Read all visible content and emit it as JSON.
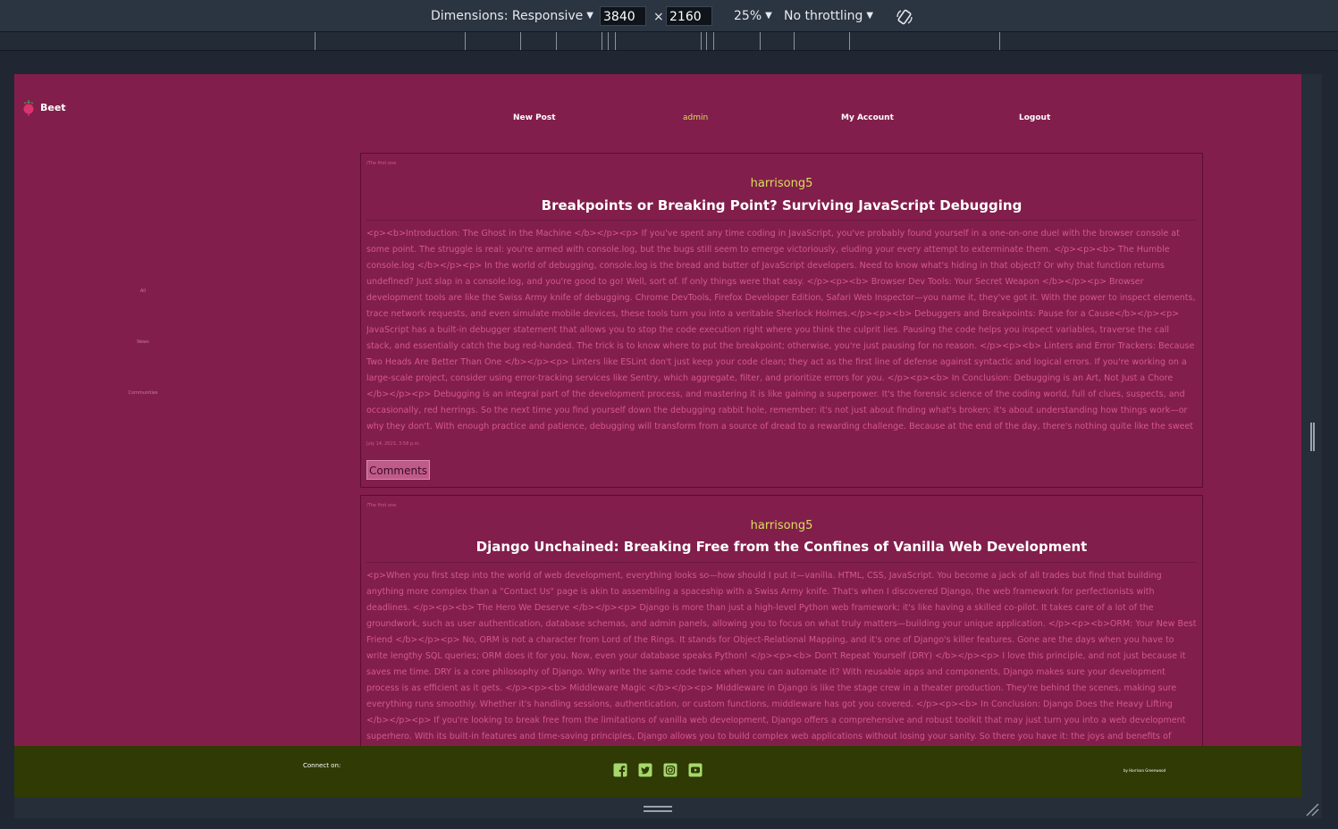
{
  "devtools": {
    "dimensions_label": "Dimensions: Responsive",
    "width_value": "3840",
    "times": "×",
    "height_value": "2160",
    "zoom": "25%",
    "throttling": "No throttling"
  },
  "site": {
    "brand": "Beet",
    "nav": {
      "new_post": "New Post",
      "admin": "admin",
      "my_account": "My Account",
      "logout": "Logout"
    },
    "sidebar": [
      "All",
      "News",
      "Communities"
    ]
  },
  "posts": [
    {
      "community": "/The first one",
      "author": "harrisong5",
      "title": "Breakpoints or Breaking Point? Surviving JavaScript Debugging",
      "body": "<p><b>Introduction: The Ghost in the Machine </b></p><p> If you've spent any time coding in JavaScript, you've probably found yourself in a one-on-one duel with the browser console at some point. The struggle is real: you're armed with console.log, but the bugs still seem to emerge victoriously, eluding your every attempt to exterminate them. </p><p><b> The Humble console.log </b></p><p> In the world of debugging, console.log is the bread and butter of JavaScript developers. Need to know what's hiding in that object? Or why that function returns undefined? Just slap in a console.log, and you're good to go! Well, sort of. If only things were that easy. </p><p><b> Browser Dev Tools: Your Secret Weapon </b></p><p> Browser development tools are like the Swiss Army knife of debugging. Chrome DevTools, Firefox Developer Edition, Safari Web Inspector—you name it, they've got it. With the power to inspect elements, trace network requests, and even simulate mobile devices, these tools turn you into a veritable Sherlock Holmes.</p><p><b> Debuggers and Breakpoints: Pause for a Cause</b></p><p> JavaScript has a built-in debugger statement that allows you to stop the code execution right where you think the culprit lies. Pausing the code helps you inspect variables, traverse the call stack, and essentially catch the bug red-handed. The trick is to know where to put the breakpoint; otherwise, you're just pausing for no reason. </p><p><b> Linters and Error Trackers: Because Two Heads Are Better Than One </b></p><p> Linters like ESLint don't just keep your code clean; they act as the first line of defense against syntactic and logical errors. If you're working on a large-scale project, consider using error-tracking services like Sentry, which aggregate, filter, and prioritize errors for you. </p><p><b> In Conclusion: Debugging is an Art, Not Just a Chore </b></p><p> Debugging is an integral part of the development process, and mastering it is like gaining a superpower. It's the forensic science of the coding world, full of clues, suspects, and occasionally, red herrings. So the next time you find yourself down the debugging rabbit hole, remember: it's not just about finding what's broken; it's about understanding how things work—or why they don't. With enough practice and patience, debugging will transform from a source of dread to a rewarding challenge. Because at the end of the day, there's nothing quite like the sweet victory of a bug-free script.</p>",
      "date": "July 14, 2023, 3:58 p.m.",
      "comments_label": "Comments"
    },
    {
      "community": "/The first one",
      "author": "harrisong5",
      "title": "Django Unchained: Breaking Free from the Confines of Vanilla Web Development",
      "body": "<p>When you first step into the world of web development, everything looks so—how should I put it—vanilla. HTML, CSS, JavaScript. You become a jack of all trades but find that building anything more complex than a \"Contact Us\" page is akin to assembling a spaceship with a Swiss Army knife. That's when I discovered Django, the web framework for perfectionists with deadlines. </p><p><b> The Hero We Deserve </b></p><p> Django is more than just a high-level Python web framework; it's like having a skilled co-pilot. It takes care of a lot of the groundwork, such as user authentication, database schemas, and admin panels, allowing you to focus on what truly matters—building your unique application. </p><p><b>ORM: Your New Best Friend </b></p><p> No, ORM is not a character from Lord of the Rings. It stands for Object-Relational Mapping, and it's one of Django's killer features. Gone are the days when you have to write lengthy SQL queries; ORM does it for you. Now, even your database speaks Python! </p><p><b> Don't Repeat Yourself (DRY) </b></p><p> I love this principle, and not just because it saves me time. DRY is a core philosophy of Django. Why write the same code twice when you can automate it? With reusable apps and components, Django makes sure your development process is as efficient as it gets. </p><p><b> Middleware Magic </b></p><p> Middleware in Django is like the stage crew in a theater production. They're behind the scenes, making sure everything runs smoothly. Whether it's handling sessions, authentication, or custom functions, middleware has got you covered. </p><p><b> In Conclusion: Django Does the Heavy Lifting </b></p><p> If you're looking to break free from the limitations of vanilla web development, Django offers a comprehensive and robust toolkit that may just turn you into a web development superhero. With its built-in features and time-saving principles, Django allows you to build complex web applications without losing your sanity. So there you have it: the joys and benefits of Django, demystified. If you've been sitting on the fence about diving into frameworks, I hope this blog gives you that gentle nudge to start exploring. Trust me, once you go Django, you'll wonder how you ever"
    }
  ],
  "footer": {
    "connect_label": "Connect on:",
    "social": [
      "facebook-icon",
      "twitter-icon",
      "instagram-icon",
      "youtube-icon"
    ],
    "credit": "by Harrison Greenwood"
  },
  "colors": {
    "page_bg": "#821e4b",
    "footer_bg": "#2f3a05",
    "accent": "#d8df5a",
    "body_text": "#d4588c"
  }
}
